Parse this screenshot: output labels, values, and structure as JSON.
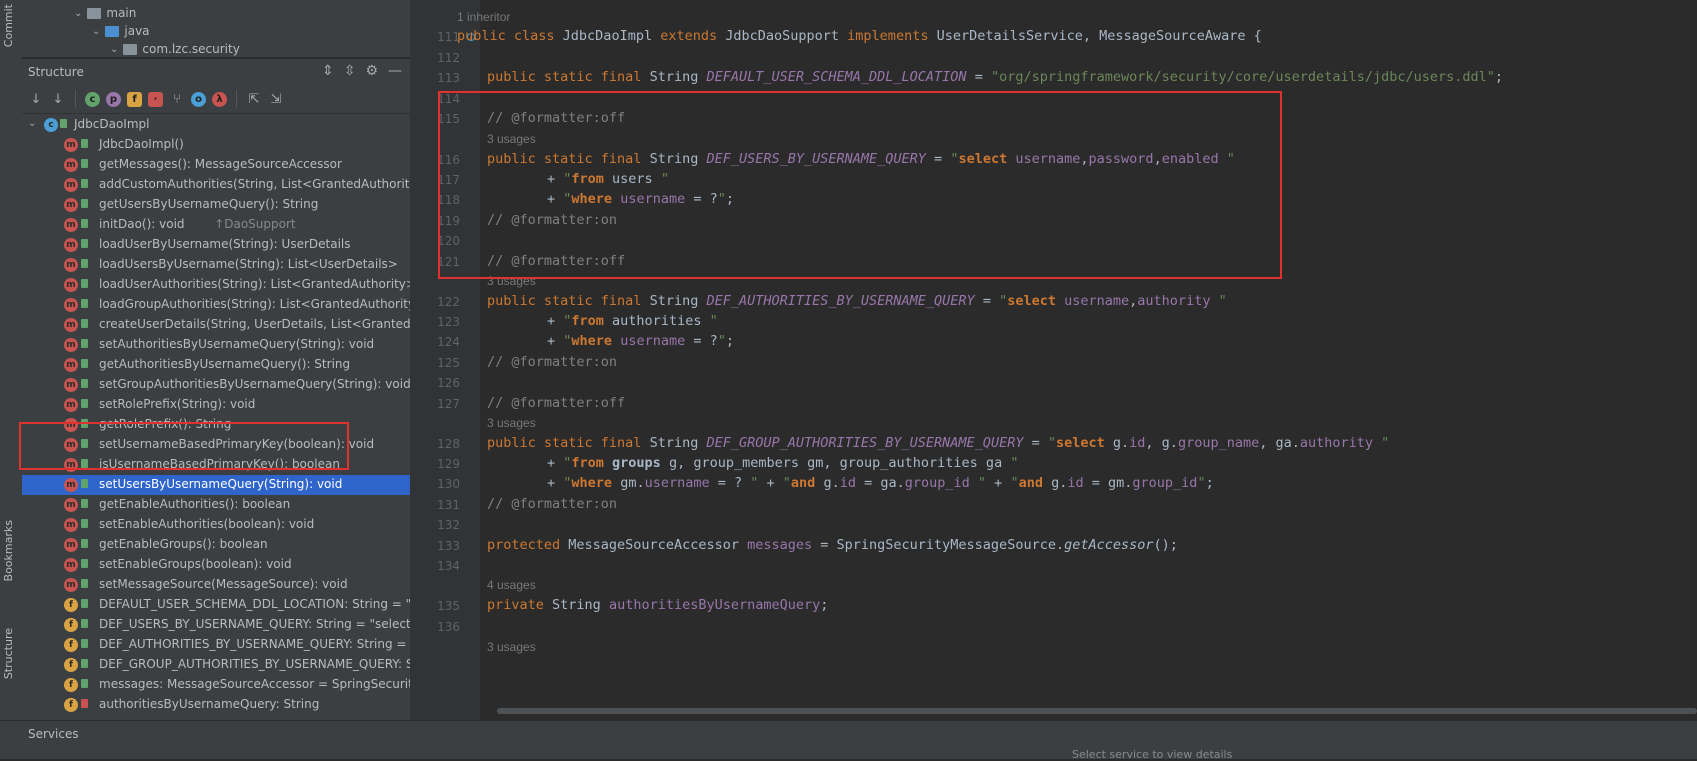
{
  "left_strip": {
    "top_tab": "Commit",
    "bookmarks_tab": "Bookmarks",
    "structure_tab": "Structure"
  },
  "project_tree": [
    {
      "label": "main"
    },
    {
      "label": "java"
    },
    {
      "label": "com.lzc.security"
    }
  ],
  "structure": {
    "title": "Structure",
    "root": "JdbcDaoImpl",
    "items": [
      {
        "kind": "m",
        "access": "pub",
        "label": "JdbcDaoImpl()",
        "suffix": ""
      },
      {
        "kind": "m",
        "access": "pub",
        "label": "getMessages(): MessageSourceAccessor",
        "suffix": ""
      },
      {
        "kind": "m",
        "access": "pub",
        "label": "addCustomAuthorities(String, List<GrantedAuthority>",
        "suffix": ""
      },
      {
        "kind": "m",
        "access": "pub",
        "label": "getUsersByUsernameQuery(): String",
        "suffix": ""
      },
      {
        "kind": "m",
        "access": "pub",
        "label": "initDao(): void ",
        "suffix": "↑DaoSupport"
      },
      {
        "kind": "m",
        "access": "pub",
        "label": "loadUserByUsername(String): UserDetails",
        "suffix": ""
      },
      {
        "kind": "m",
        "access": "pub",
        "label": "loadUsersByUsername(String): List<UserDetails>",
        "suffix": ""
      },
      {
        "kind": "m",
        "access": "pub",
        "label": "loadUserAuthorities(String): List<GrantedAuthority>",
        "suffix": ""
      },
      {
        "kind": "m",
        "access": "pub",
        "label": "loadGroupAuthorities(String): List<GrantedAuthority>",
        "suffix": ""
      },
      {
        "kind": "m",
        "access": "pub",
        "label": "createUserDetails(String, UserDetails, List<GrantedAu",
        "suffix": ""
      },
      {
        "kind": "m",
        "access": "pub",
        "label": "setAuthoritiesByUsernameQuery(String): void",
        "suffix": ""
      },
      {
        "kind": "m",
        "access": "pub",
        "label": "getAuthoritiesByUsernameQuery(): String",
        "suffix": ""
      },
      {
        "kind": "m",
        "access": "pub",
        "label": "setGroupAuthoritiesByUsernameQuery(String): void",
        "suffix": ""
      },
      {
        "kind": "m",
        "access": "pub",
        "label": "setRolePrefix(String): void",
        "suffix": ""
      },
      {
        "kind": "m",
        "access": "pub",
        "label": "getRolePrefix(): String",
        "suffix": ""
      },
      {
        "kind": "m",
        "access": "pub",
        "label": "setUsernameBasedPrimaryKey(boolean): void",
        "suffix": ""
      },
      {
        "kind": "m",
        "access": "pub",
        "label": "isUsernameBasedPrimaryKey(): boolean",
        "suffix": ""
      },
      {
        "kind": "m",
        "access": "pub",
        "label": "setUsersByUsernameQuery(String): void",
        "suffix": "",
        "selected": true
      },
      {
        "kind": "m",
        "access": "pub",
        "label": "getEnableAuthorities(): boolean",
        "suffix": ""
      },
      {
        "kind": "m",
        "access": "pub",
        "label": "setEnableAuthorities(boolean): void",
        "suffix": ""
      },
      {
        "kind": "m",
        "access": "pub",
        "label": "getEnableGroups(): boolean",
        "suffix": ""
      },
      {
        "kind": "m",
        "access": "pub",
        "label": "setEnableGroups(boolean): void",
        "suffix": ""
      },
      {
        "kind": "m",
        "access": "pub",
        "label": "setMessageSource(MessageSource): void",
        "suffix": ""
      },
      {
        "kind": "f",
        "access": "pub",
        "label": "DEFAULT_USER_SCHEMA_DDL_LOCATION: String = \"c",
        "suffix": ""
      },
      {
        "kind": "f",
        "access": "pub",
        "label": "DEF_USERS_BY_USERNAME_QUERY: String = \"select u",
        "suffix": ""
      },
      {
        "kind": "f",
        "access": "pub",
        "label": "DEF_AUTHORITIES_BY_USERNAME_QUERY: String = \"",
        "suffix": ""
      },
      {
        "kind": "f",
        "access": "pub",
        "label": "DEF_GROUP_AUTHORITIES_BY_USERNAME_QUERY: St",
        "suffix": ""
      },
      {
        "kind": "f",
        "access": "pub",
        "label": "messages: MessageSourceAccessor = SpringSecurity",
        "suffix": ""
      },
      {
        "kind": "f",
        "access": "priv",
        "label": "authoritiesByUsernameQuery: String",
        "suffix": ""
      }
    ]
  },
  "editor": {
    "inheritor_hint": "1 inheritor",
    "usage_hints": {
      "u115": "3 usages",
      "u121": "3 usages",
      "u127": "3 usages",
      "u134": "4 usages",
      "u136": "3 usages"
    },
    "line_numbers": [
      "111",
      "112",
      "113",
      "114",
      "115",
      "116",
      "117",
      "118",
      "119",
      "120",
      "121",
      "122",
      "123",
      "124",
      "125",
      "126",
      "127",
      "128",
      "129",
      "130",
      "131",
      "132",
      "133",
      "134",
      "135",
      "136"
    ]
  },
  "bottom": {
    "services_label": "Services",
    "services_hint": "Select service to view details"
  },
  "colors": {
    "selection": "#2f65ca",
    "annotation": "#e03131",
    "keyword": "#cc7832",
    "string": "#6a8759",
    "constant": "#9876aa"
  }
}
